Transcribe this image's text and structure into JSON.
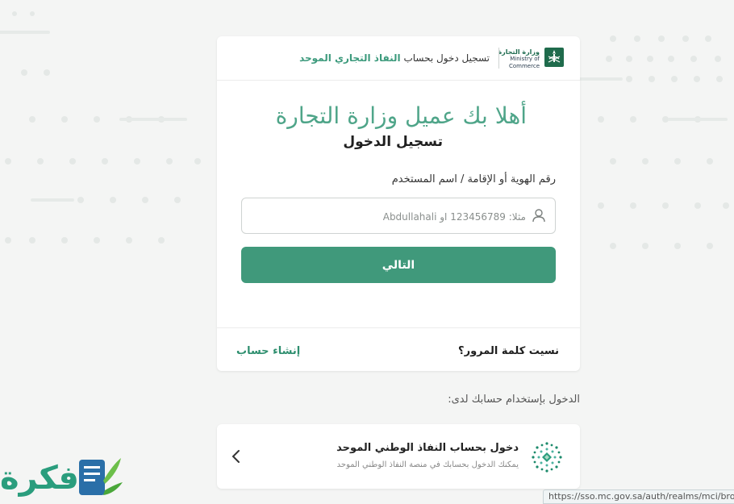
{
  "header": {
    "logo_ar": "وزارة التجارة",
    "logo_en": "Ministry of Commerce",
    "title_prefix": "تسجيل دخول بحساب",
    "title_brand": "النفاذ التجاري الموحد"
  },
  "login": {
    "welcome": "أهلا بك عميل وزارة التجارة",
    "subtitle": "تسجيل الدخول",
    "field_label": "رقم الهوية أو الإقامة / اسم المستخدم",
    "field_value": "",
    "field_placeholder": "مثلا: 123456789 او Abdullahali",
    "next_button": "التالي"
  },
  "footer": {
    "forgot_password": "نسيت كلمة المرور؟",
    "create_account": "إنشاء حساب"
  },
  "alt_login": {
    "label": "الدخول بإستخدام حسابك لدى:",
    "nafath_title": "دخول بحساب النفاذ الوطني الموحد",
    "nafath_desc": "يمكنك الدخول بحسابك في منصة النفاذ الوطني الموحد"
  },
  "watermark": {
    "text": "فكرة"
  },
  "status_bar": {
    "url": "https://sso.mc.gov.sa/auth/realms/mci/brok"
  },
  "colors": {
    "accent": "#40997b",
    "heading": "#4fa589",
    "background": "#f4f5f4"
  }
}
